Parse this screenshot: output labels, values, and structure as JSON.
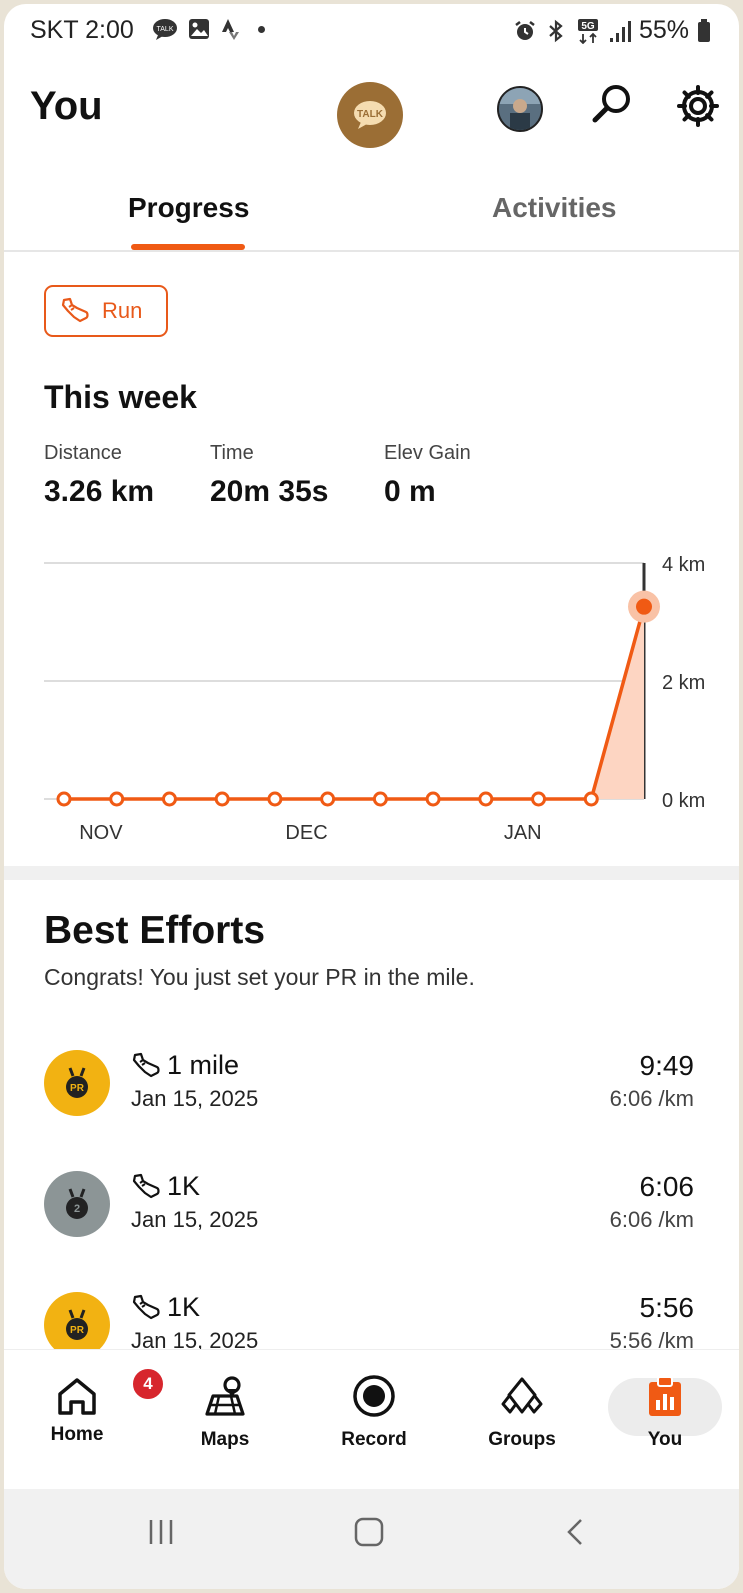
{
  "status_bar": {
    "time": "SKT 2:00",
    "battery": "55%",
    "network": "5G"
  },
  "header": {
    "title": "You",
    "talk_label": "TALK"
  },
  "tabs": [
    {
      "label": "Progress",
      "active": true
    },
    {
      "label": "Activities",
      "active": false
    }
  ],
  "filter": {
    "sport": "Run"
  },
  "week": {
    "title": "This week",
    "stats": [
      {
        "label": "Distance",
        "value": "3.26 km"
      },
      {
        "label": "Time",
        "value": "20m 35s"
      },
      {
        "label": "Elev Gain",
        "value": "0 m"
      }
    ]
  },
  "chart_data": {
    "type": "line",
    "x_month_labels": [
      "NOV",
      "DEC",
      "JAN"
    ],
    "y_tick_labels": [
      "4 km",
      "2 km",
      "0 km"
    ],
    "y_ticks": [
      4,
      2,
      0
    ],
    "ylim": [
      0,
      4
    ],
    "values": [
      0,
      0,
      0,
      0,
      0,
      0,
      0,
      0,
      0,
      0,
      0,
      3.26
    ],
    "highlight_last": true,
    "colors": {
      "line": "#f05a14",
      "fill": "#fdd5c2",
      "highlight": "#f9c2a6"
    }
  },
  "best_efforts": {
    "title": "Best Efforts",
    "subtitle": "Congrats! You just set your PR in the mile.",
    "items": [
      {
        "name": "1 mile",
        "date": "Jan 15, 2025",
        "time": "9:49",
        "pace": "6:06 /km",
        "medal": "PR",
        "medal_color": "#f2b212"
      },
      {
        "name": "1K",
        "date": "Jan 15, 2025",
        "time": "6:06",
        "pace": "6:06 /km",
        "medal": "2",
        "medal_color": "#8c9596"
      },
      {
        "name": "1K",
        "date": "Jan 15, 2025",
        "time": "5:56",
        "pace": "5:56 /km",
        "medal": "PR",
        "medal_color": "#f2b212"
      }
    ]
  },
  "bottom_nav": {
    "items": [
      {
        "label": "Home",
        "icon": "home-icon"
      },
      {
        "label": "Maps",
        "icon": "maps-icon"
      },
      {
        "label": "Record",
        "icon": "record-icon"
      },
      {
        "label": "Groups",
        "icon": "groups-icon"
      },
      {
        "label": "You",
        "icon": "you-icon",
        "active": true
      }
    ],
    "home_badge": "4"
  },
  "accent_color": "#f05a14"
}
